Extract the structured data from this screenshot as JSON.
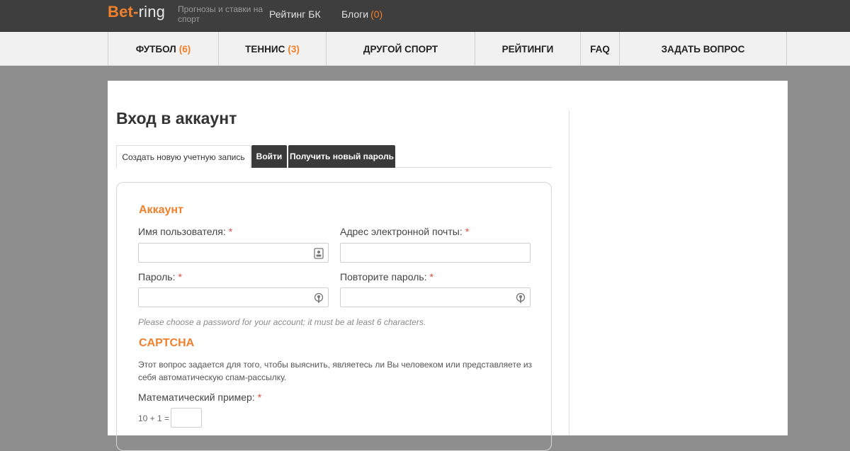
{
  "header": {
    "logo_part1": "Bet-",
    "logo_part2": "ring",
    "tagline": "Прогнозы и ставки на спорт",
    "links": [
      {
        "label": "Рейтинг БК",
        "count": ""
      },
      {
        "label": "Блоги",
        "count": "(0)"
      }
    ]
  },
  "nav": {
    "items": [
      {
        "label": "ФУТБОЛ",
        "count": "(6)"
      },
      {
        "label": "ТЕННИС",
        "count": "(3)"
      },
      {
        "label": "ДРУГОЙ СПОРТ",
        "count": ""
      },
      {
        "label": "РЕЙТИНГИ",
        "count": ""
      },
      {
        "label": "FAQ",
        "count": ""
      },
      {
        "label": "ЗАДАТЬ ВОПРОС",
        "count": ""
      }
    ]
  },
  "page": {
    "title": "Вход в аккаунт",
    "tabs": [
      {
        "label": "Создать новую учетную запись",
        "active": true
      },
      {
        "label": "Войти",
        "active": false
      },
      {
        "label": "Получить новый пароль",
        "active": false
      }
    ]
  },
  "form": {
    "account_title": "Аккаунт",
    "username_label": "Имя пользователя:",
    "email_label": "Адрес электронной почты:",
    "password_label": "Пароль:",
    "password_repeat_label": "Повторите пароль:",
    "required_mark": "*",
    "username_value": "",
    "email_value": "",
    "password_value": "",
    "password_repeat_value": "",
    "password_hint": "Please choose a password for your account; it must be at least 6 characters.",
    "captcha_title": "CAPTCHA",
    "captcha_description": "Этот вопрос задается для того, чтобы выяснить, являетесь ли Вы человеком или представляете из себя автоматическую спам-рассылку.",
    "math_label": "Математический пример:",
    "math_question": "10 + 1 =",
    "math_answer": ""
  },
  "colors": {
    "accent": "#f0802c",
    "topbar": "#3e3e3e",
    "nav_bg": "#f1f1f1",
    "page_bg": "#8e8e8e",
    "required": "#e04a3a"
  }
}
